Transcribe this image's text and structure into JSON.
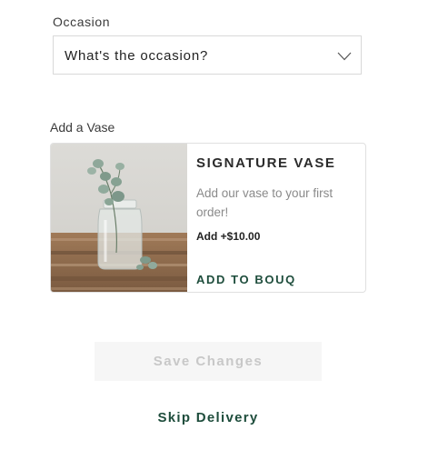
{
  "occasion": {
    "label": "Occasion",
    "placeholder": "What's the occasion?",
    "icon": "chevron-down-icon"
  },
  "vase": {
    "section_label": "Add a Vase",
    "title": "SIGNATURE VASE",
    "description": "Add our vase to your first order!",
    "price": "Add +$10.00",
    "action_label": "ADD TO BOUQ",
    "accent_color": "#1e4d3c"
  },
  "actions": {
    "save_label": "Save Changes",
    "skip_label": "Skip Delivery"
  }
}
